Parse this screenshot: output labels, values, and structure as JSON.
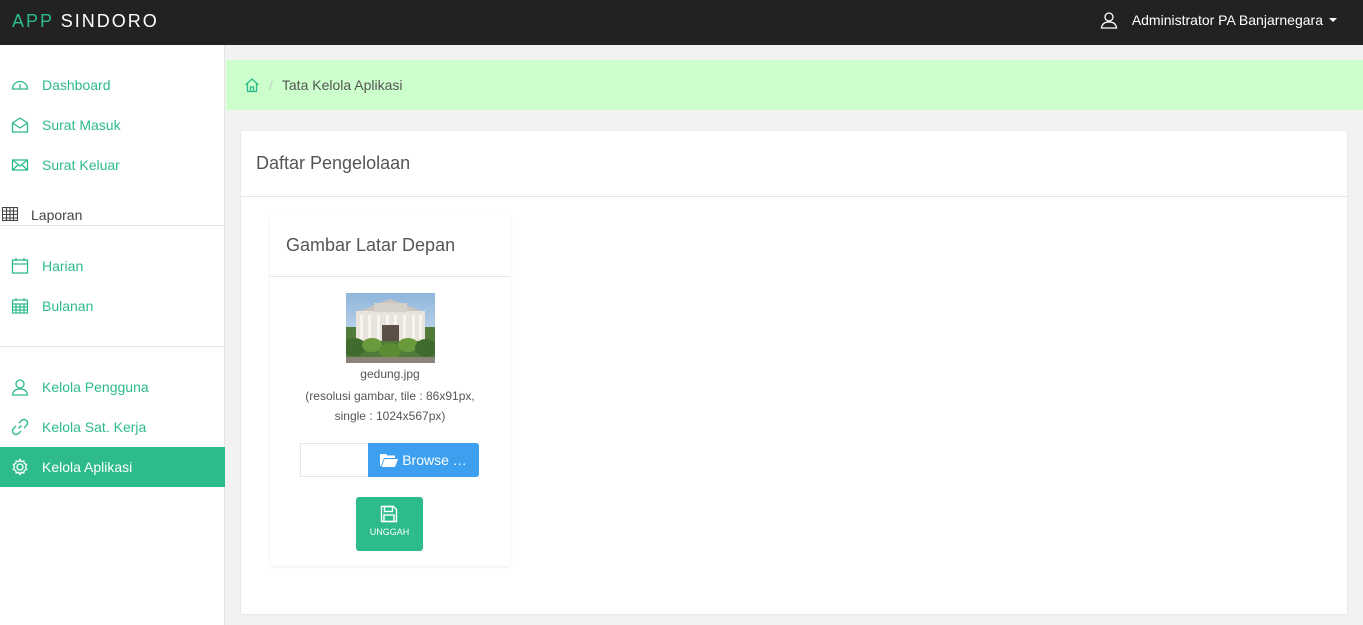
{
  "app": {
    "brand_part1": "APP",
    "brand_part2": "SINDORO"
  },
  "header": {
    "user_name": "Administrator PA Banjarnegara"
  },
  "sidebar": {
    "items": [
      {
        "label": "Dashboard",
        "icon": "dashboard-icon"
      },
      {
        "label": "Surat Masuk",
        "icon": "envelope-open-icon"
      },
      {
        "label": "Surat Keluar",
        "icon": "envelope-icon"
      }
    ],
    "section_label": "Laporan",
    "report_items": [
      {
        "label": "Harian",
        "icon": "calendar-icon"
      },
      {
        "label": "Bulanan",
        "icon": "calendar-grid-icon"
      }
    ],
    "admin_items": [
      {
        "label": "Kelola Pengguna",
        "icon": "user-icon"
      },
      {
        "label": "Kelola Sat. Kerja",
        "icon": "link-icon"
      },
      {
        "label": "Kelola Aplikasi",
        "icon": "gear-icon",
        "active": true
      }
    ]
  },
  "breadcrumb": {
    "current": "Tata Kelola Aplikasi"
  },
  "main": {
    "panel_title": "Daftar Pengelolaan",
    "card": {
      "title": "Gambar Latar Depan",
      "filename": "gedung.jpg",
      "note_line1": "(resolusi gambar, tile : 86x91px,",
      "note_line2": "single : 1024x567px)",
      "browse_label": "Browse …",
      "upload_label": "UNGGAH"
    }
  },
  "colors": {
    "accent": "#2dbb8d",
    "topbar": "#222222",
    "breadcrumb_bg": "#ccffcc",
    "browse": "#3c9ff0"
  }
}
